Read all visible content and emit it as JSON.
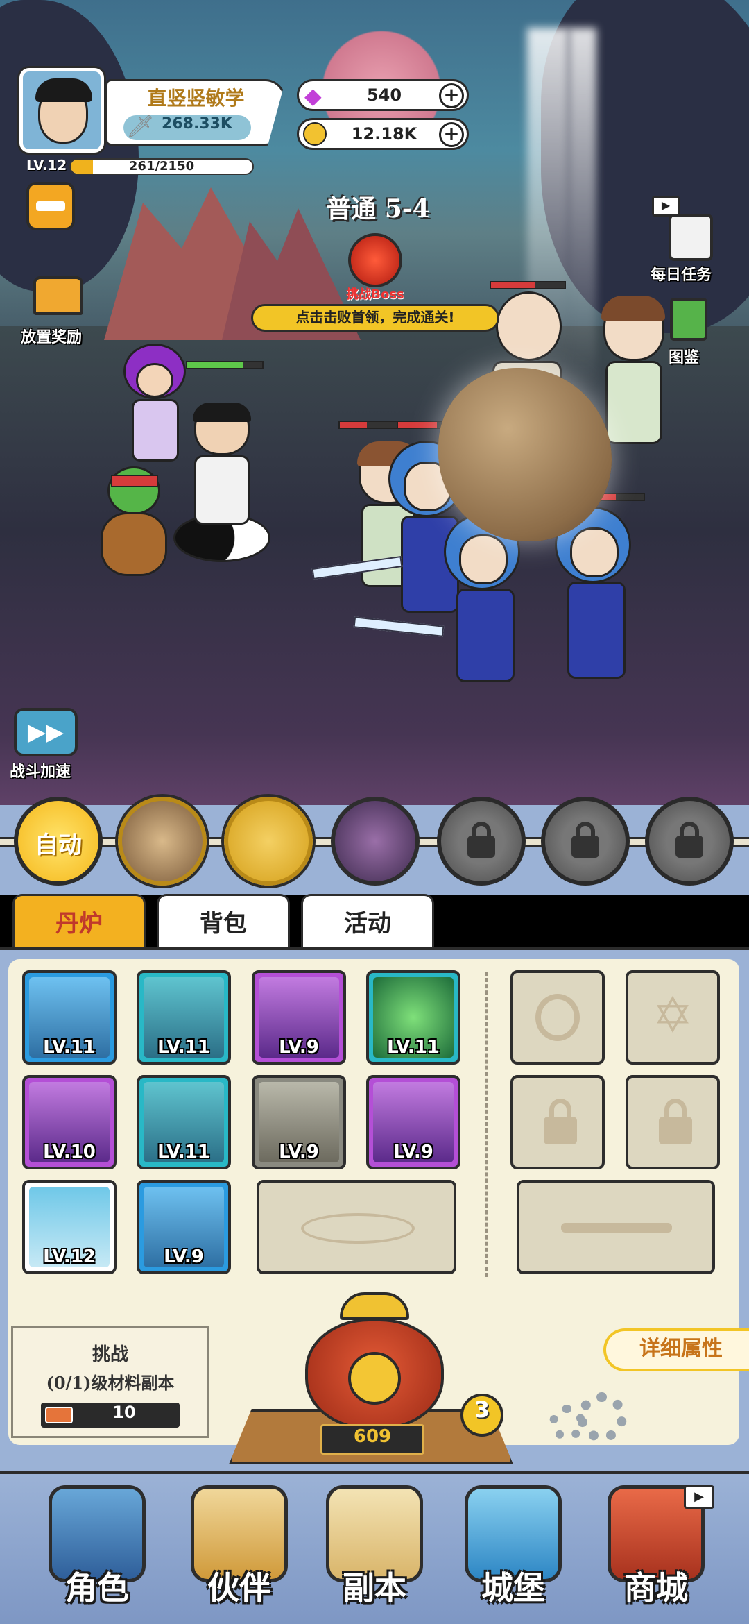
{
  "player": {
    "name": "直竖竖敏学",
    "power": "268.33K",
    "level": "LV.12",
    "exp": "261/2150",
    "exp_fraction": 0.121
  },
  "currency": {
    "gems": "540",
    "coins": "12.18K"
  },
  "stage": {
    "title": "普通 5-4",
    "boss_label": "挑战Boss",
    "hint": "点击击败首领，完成通关!"
  },
  "side_left": {
    "idle_reward": "放置奖励",
    "battle_speed": "战斗加速"
  },
  "side_right": {
    "daily_tasks": "每日任务",
    "codex": "图鉴"
  },
  "skills": {
    "auto_label": "自动"
  },
  "tabs": [
    "丹炉",
    "背包",
    "活动"
  ],
  "equipment": [
    {
      "lv": "LV.11"
    },
    {
      "lv": "LV.11"
    },
    {
      "lv": "LV.9"
    },
    {
      "lv": "LV.11"
    },
    {
      "lv": "LV.10"
    },
    {
      "lv": "LV.11"
    },
    {
      "lv": "LV.9"
    },
    {
      "lv": "LV.9"
    },
    {
      "lv": "LV.12"
    },
    {
      "lv": "LV.9"
    }
  ],
  "furnace": {
    "detail_button": "详细属性",
    "challenge_title": "挑战",
    "challenge_desc": "(0/1)级材料副本",
    "challenge_cost": "10",
    "furnace_level": "3",
    "furnace_value": "609"
  },
  "nav": [
    "角色",
    "伙伴",
    "副本",
    "城堡",
    "商城"
  ]
}
